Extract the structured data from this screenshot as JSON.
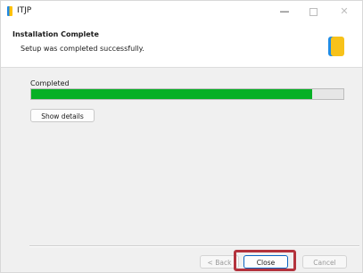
{
  "window": {
    "title": "ITJP",
    "controls": {
      "minimize": "—",
      "close": "✕"
    }
  },
  "header": {
    "title": "Installation Complete",
    "subtitle": "Setup was completed successfully."
  },
  "main": {
    "status_label": "Completed",
    "progress": 0.9,
    "progress_color": "#06b025",
    "show_details_label": "Show details"
  },
  "footer": {
    "back_label": "< Back",
    "close_label": "Close",
    "cancel_label": "Cancel"
  },
  "colors": {
    "highlight": "#b3333d",
    "accent": "#0a64c2"
  }
}
